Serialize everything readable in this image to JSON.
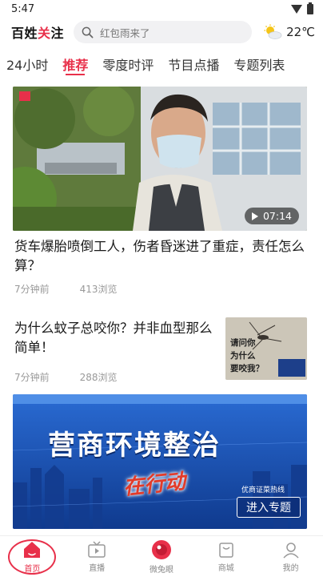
{
  "status": {
    "time": "5:47"
  },
  "header": {
    "logo_part1": "百姓",
    "logo_part2": "关",
    "logo_part3": "注",
    "search_placeholder": "红包雨来了",
    "weather_temp": "22℃"
  },
  "tabs": [
    {
      "label": "24小时",
      "active": false
    },
    {
      "label": "推荐",
      "active": true
    },
    {
      "label": "零度时评",
      "active": false
    },
    {
      "label": "节目点播",
      "active": false
    },
    {
      "label": "专题列表",
      "active": false
    }
  ],
  "articles": [
    {
      "title": "货车爆胎喷倒工人，伤者昏迷进了重症，责任怎么算？",
      "time_ago": "7分钟前",
      "views": "413浏览",
      "duration": "07:14"
    },
    {
      "title": "为什么蚊子总咬你？并非血型那么简单！",
      "time_ago": "7分钟前",
      "views": "288浏览",
      "thumb_caption_1": "请问你",
      "thumb_caption_2": "为什么",
      "thumb_caption_3": "要咬我？"
    }
  ],
  "banner": {
    "headline": "营商环境整治",
    "sub": "在行动",
    "hotline": "优商证菜热线",
    "cta": "进入专题"
  },
  "bottom_nav": [
    {
      "label": "首页",
      "icon": "home-icon",
      "active": true
    },
    {
      "label": "直播",
      "icon": "tv-icon",
      "active": false
    },
    {
      "label": "微兔眼",
      "icon": "eye-icon",
      "active": false
    },
    {
      "label": "商城",
      "icon": "bag-icon",
      "active": false
    },
    {
      "label": "我的",
      "icon": "user-icon",
      "active": false
    }
  ],
  "colors": {
    "accent": "#e8304a",
    "banner_blue": "#1e5bbf"
  }
}
